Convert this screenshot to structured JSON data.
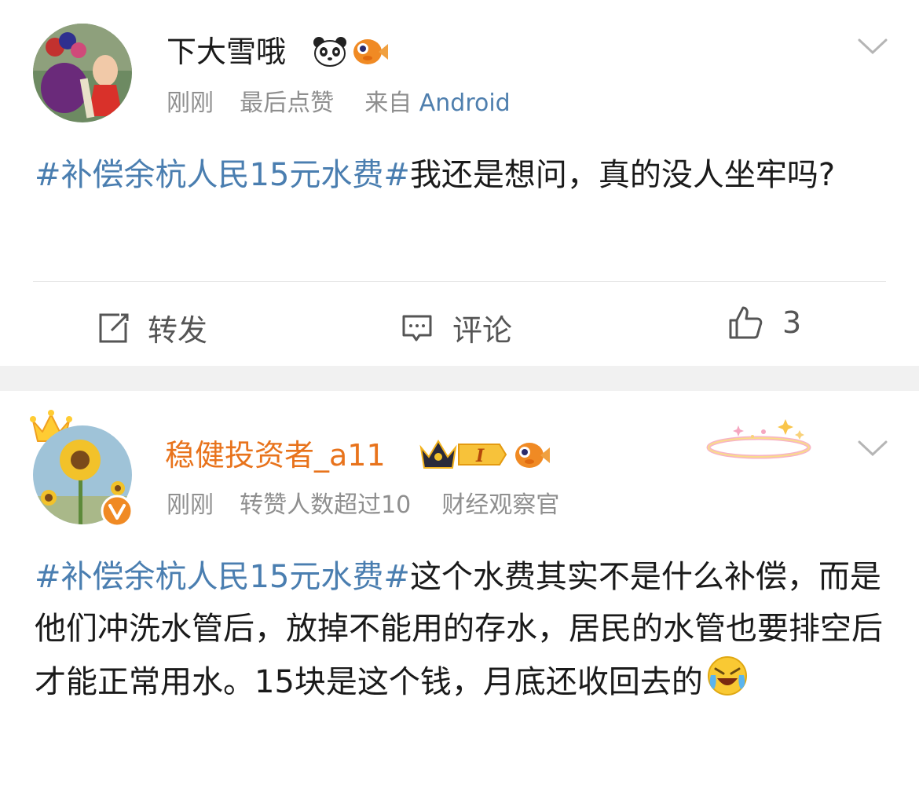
{
  "post1": {
    "username": "下大雪哦",
    "time": "刚刚",
    "note": "最后点赞",
    "source_prefix": "来自",
    "source": "Android",
    "topic": "#补偿余杭人民15元水费#",
    "text": "我还是想问，真的没人坐牢吗?",
    "actions": {
      "repost_label": "转发",
      "comment_label": "评论",
      "like_count": "3"
    },
    "icons": [
      "panda-emoji",
      "goldfish-badge",
      "chevron-down-icon",
      "repost-icon",
      "comment-icon",
      "thumbs-up-icon"
    ]
  },
  "post2": {
    "username": "稳健投资者_a11",
    "level_badge": "I",
    "time": "刚刚",
    "note": "转赞人数超过10",
    "tag": "财经观察官",
    "topic": "#补偿余杭人民15元水费#",
    "text": "这个水费其实不是什么补偿，而是他们冲洗水管后，放掉不能用的存水，居民的水管也要排空后才能正常用水。15块是这个钱，月底还收回去的",
    "colors": {
      "vip_name": "#e8731c",
      "topic": "#4a7eb0",
      "verified": "#f08a24"
    }
  }
}
